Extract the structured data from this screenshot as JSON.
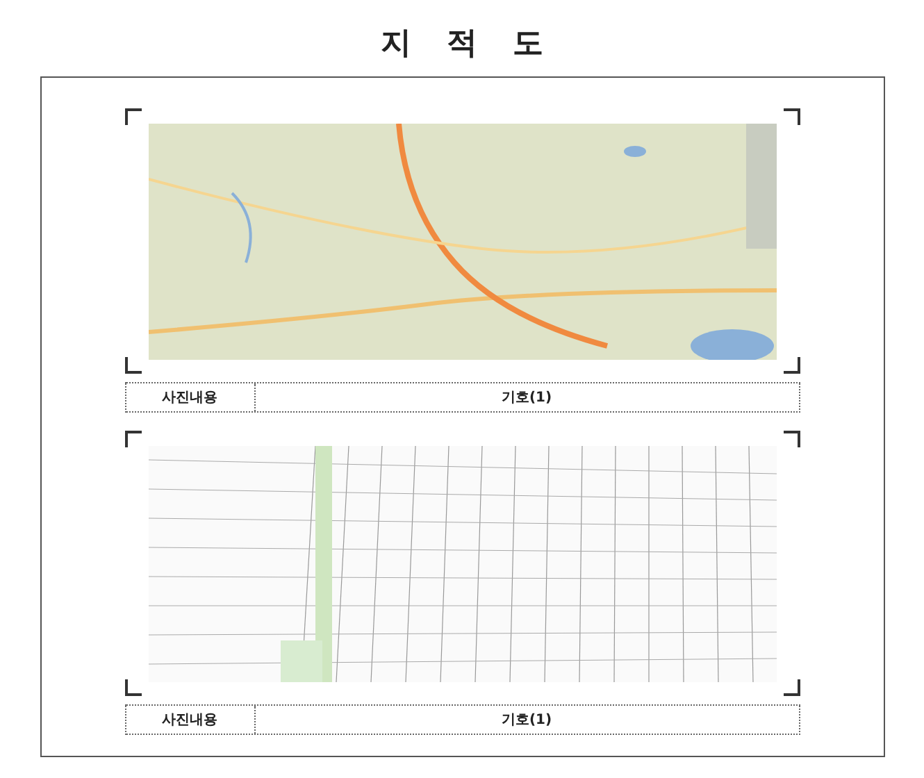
{
  "title": "지 적 도",
  "photos": [
    {
      "kind": "map",
      "caption_label": "사진내용",
      "caption_value": "기호(1)"
    },
    {
      "kind": "cadastral",
      "caption_label": "사진내용",
      "caption_value": "기호(1)"
    }
  ]
}
